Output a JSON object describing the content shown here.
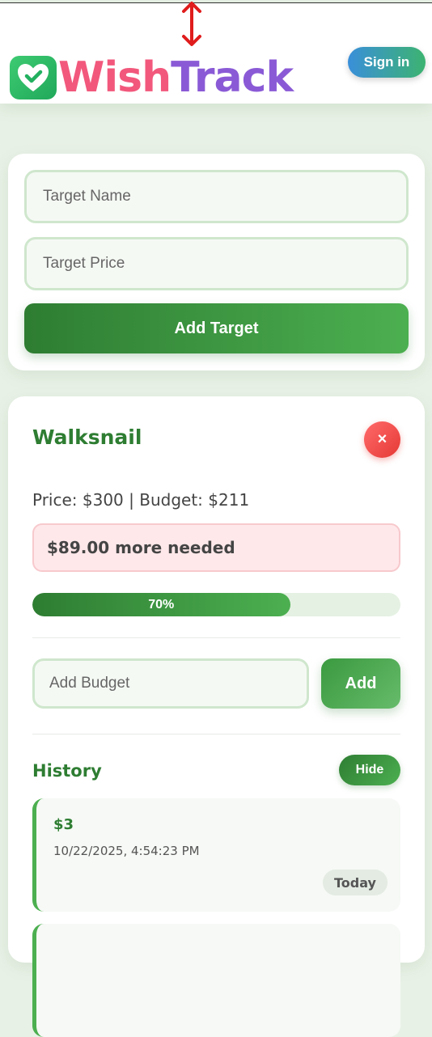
{
  "header": {
    "logo_wish": "Wish",
    "logo_track": "Track",
    "signin_label": "Sign in"
  },
  "add_target": {
    "name_placeholder": "Target Name",
    "price_placeholder": "Target Price",
    "button_label": "Add Target"
  },
  "target": {
    "title": "Walksnail",
    "delete_label": "×",
    "price_line": "Price: $300 | Budget: $211",
    "needed_text": "$89.00 more needed",
    "progress_percent": 70,
    "progress_label": "70%",
    "budget_placeholder": "Add Budget",
    "add_label": "Add",
    "history_title": "History",
    "hide_label": "Hide",
    "history": [
      {
        "amount": "$3",
        "date": "10/22/2025, 4:54:23 PM",
        "badge": "Today"
      }
    ]
  },
  "colors": {
    "accent_green": "#2e7d32",
    "logo_pink": "#f2587c",
    "logo_purple": "#8a5ad6",
    "danger": "#e53935",
    "background": "#e8f1e6"
  },
  "icons": [
    "heart-check-icon",
    "close-icon",
    "resize-cursor-icon"
  ]
}
